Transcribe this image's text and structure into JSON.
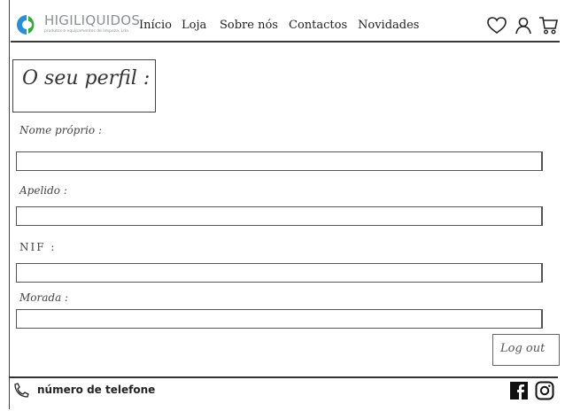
{
  "header": {
    "logo_name": "HIGILIQUIDOS",
    "logo_tagline": "produtos e equipamentos de limpeza, Lda",
    "nav": [
      "Início",
      "Loja",
      "Sobre nós",
      "Contactos",
      "Novidades"
    ],
    "icons": [
      "heart-icon",
      "user-icon",
      "cart-icon"
    ],
    "brand_colors": {
      "green": "#3aa842",
      "blue": "#2a8fd6"
    }
  },
  "profile": {
    "title": "O seu perfil :",
    "fields": [
      {
        "label": "Nome próprio :",
        "value": ""
      },
      {
        "label": "Apelido :",
        "value": ""
      },
      {
        "label": "NIF :",
        "value": ""
      },
      {
        "label": "Morada :",
        "value": ""
      }
    ],
    "logout_label": "Log out"
  },
  "footer": {
    "phone_text": "número de telefone",
    "social": [
      "facebook-icon",
      "instagram-icon"
    ]
  }
}
